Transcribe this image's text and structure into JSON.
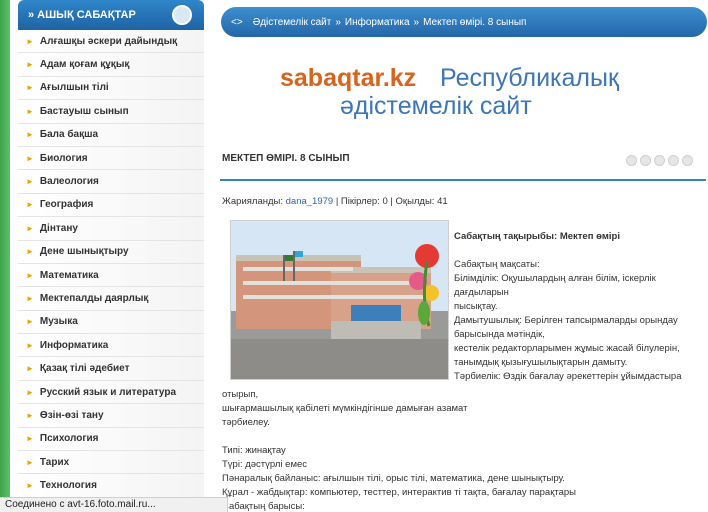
{
  "sidebar": {
    "title": "» АШЫҚ САБАҚТАР",
    "items": [
      "Алғашқы әскери дайындық",
      "Адам қоғам құқық",
      "Ағылшын тілі",
      "Бастауыш сынып",
      "Бала бақша",
      "Биология",
      "Валеология",
      "География",
      "Дінтану",
      "Дене шынықтыру",
      "Математика",
      "Мектепалды даярлық",
      "Музыка",
      "Информатика",
      "Қазақ тілі әдебиет",
      "Русский язык и литература",
      "Өзін-өзі тану",
      "Психология",
      "Тарих",
      "Технология"
    ]
  },
  "breadcrumb": {
    "items": [
      "Әдістемелік сайт",
      "Информатика",
      "Мектеп өмірі. 8 сынып"
    ],
    "separator": "»"
  },
  "logo": {
    "part1": "sabaqtar.kz",
    "part2": "Республикалық",
    "part3": "әдістемелік сайт"
  },
  "article": {
    "title": "МЕКТЕП ӨМІРІ. 8 СЫНЫП",
    "meta_prefix": "Жарияланды:",
    "author": "dana_1979",
    "meta_suffix": " | Пікірлер: 0 | Оқылды: 41",
    "lesson_title": "Сабақтың тақырыбы: Мектеп өмірі",
    "right_lines": [
      "Сабақтың мақсаты:",
      "Білімділік: Оқушылардың алған білім, іскерлік дағдыларын",
      "пысықтау.",
      "Дамытушылық: Берілген тапсырмаларды орындау барысында мәтіндік,",
      "кестелік редакторларымен жұмыс жасай білулерін, танымдық қызығушылықтарын дамыту.",
      "Тәрбиелік: Өздік бағалау әрекеттерін ұйымдастыра"
    ],
    "full_lines": [
      "отырып,",
      "шығармашылық қабілеті мүмкіндігінше дамыған азамат",
      "тәрбиелеу.",
      "",
      "Типі: жинақтау",
      "Түрі: дәстүрлі емес",
      "Пәнаралық байланыс: ағылшын тілі, орыс тілі, математика, дене шынықтыру.",
      "Құрал - жабдықтар: компьютер, тесттер, интерактив ті тақта, бағалау парақтары",
      "Сабақтың барысы:"
    ]
  },
  "status": {
    "text": "Соединено с avt-16.foto.mail.ru..."
  },
  "colors": {
    "header_blue": "#2466a8",
    "logo_orange": "#d9621c",
    "logo_blue": "#3b76b9",
    "arrow_orange": "#f2a100",
    "green_strip": "#3fa34a"
  }
}
